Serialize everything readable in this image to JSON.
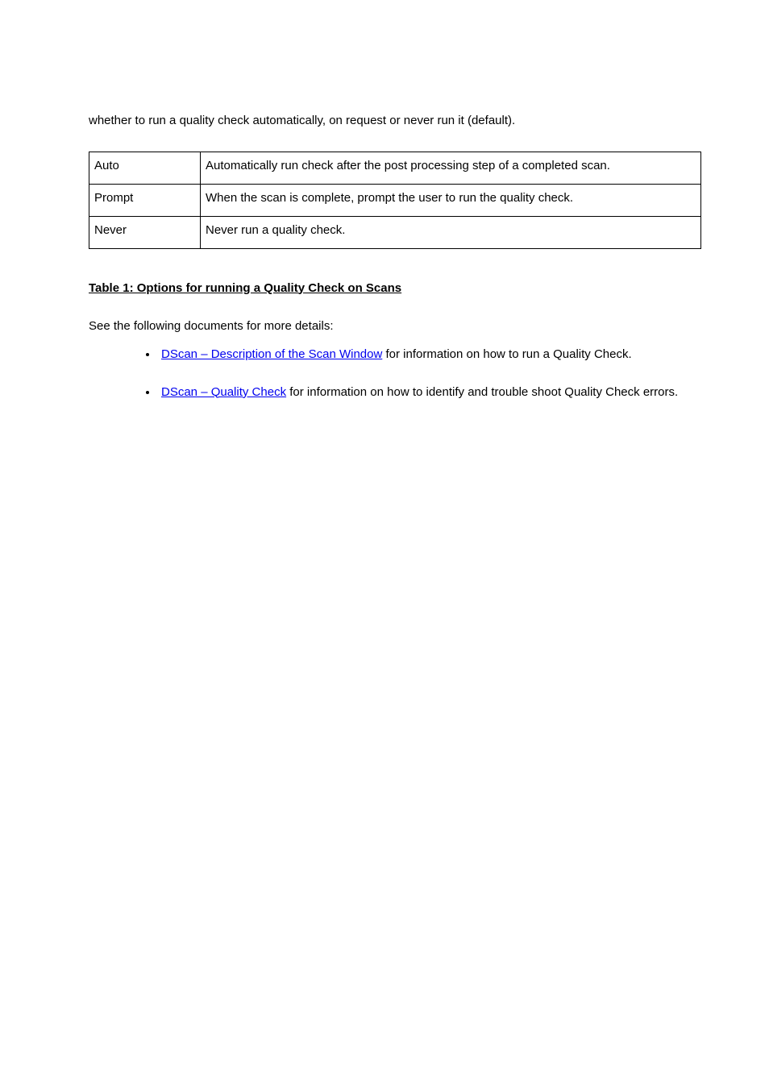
{
  "lead": "whether to run a quality check automatically, on request or never run it (default).",
  "table": {
    "rows": [
      {
        "k": "Auto",
        "v": "Automatically run check after the post processing step of a completed scan."
      },
      {
        "k": "Prompt",
        "v": "When the scan is complete, prompt the user to run the quality check."
      },
      {
        "k": "Never",
        "v": "Never run a quality check."
      }
    ]
  },
  "section_heading": "Table 1: Options for running a Quality Check on Scans",
  "intro": "See the following documents for more details:",
  "links": [
    {
      "text": "DScan – Description of the Scan Window",
      "after": " for information on how to run a Quality Check."
    },
    {
      "text": "DScan – Quality Check",
      "after": " for information on how to identify and trouble shoot Quality Check errors."
    }
  ]
}
